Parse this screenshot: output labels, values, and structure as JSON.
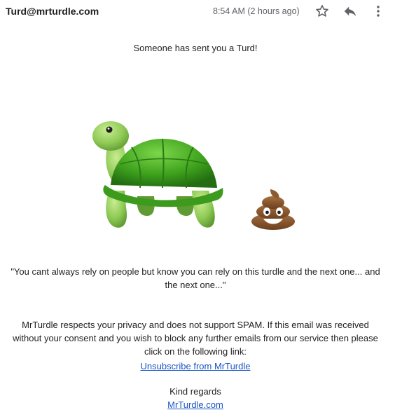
{
  "header": {
    "sender": "Turd@mrturdle.com",
    "time": "8:54 AM (2 hours ago)"
  },
  "message": {
    "title": "Someone has sent you a Turd!",
    "quote": "\"You cant always rely on people but know you can rely on this turdle and the next one... and the next one...\"",
    "privacy": "MrTurdle respects your privacy and does not support SPAM. If this email was received without your consent and you wish to block any further emails from our service then please click on the following link:",
    "unsubscribe_label": "Unsubscribe from MrTurdle",
    "regards": "Kind regards",
    "site_label": "MrTurdle.com"
  },
  "icons": {
    "star": "star-outline-icon",
    "reply": "reply-icon",
    "more": "more-vert-icon",
    "turtle": "turtle-emoji",
    "poop": "pile-of-poo-emoji"
  },
  "colors": {
    "link": "#1a56c4",
    "icon_gray": "#5f6368",
    "turtle_shell": "#3e9e1f",
    "poop_brown": "#8a5a32"
  }
}
